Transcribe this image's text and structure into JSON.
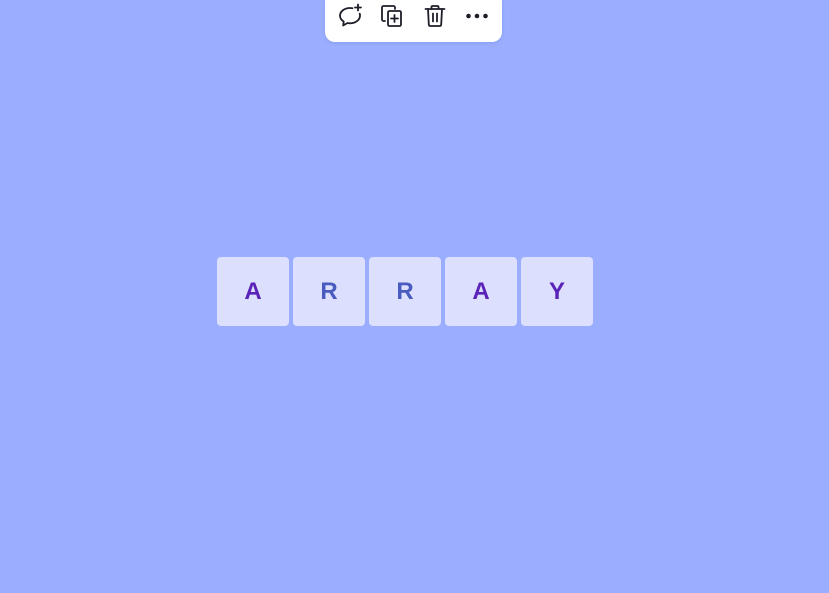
{
  "toolbar": {
    "items": [
      {
        "icon": "add-comment-icon"
      },
      {
        "icon": "duplicate-icon"
      },
      {
        "icon": "trash-icon"
      },
      {
        "icon": "more-options-icon"
      }
    ]
  },
  "tiles": [
    {
      "letter": "A",
      "color": "#5a22b8"
    },
    {
      "letter": "R",
      "color": "#4a5bbf"
    },
    {
      "letter": "R",
      "color": "#4a5bbf"
    },
    {
      "letter": "A",
      "color": "#5a22b8"
    },
    {
      "letter": "Y",
      "color": "#5a22b8"
    }
  ],
  "colors": {
    "background": "#9aadff",
    "tile_background": "#dcdffd",
    "toolbar_background": "#ffffff",
    "icon": "#1e1e2a"
  }
}
